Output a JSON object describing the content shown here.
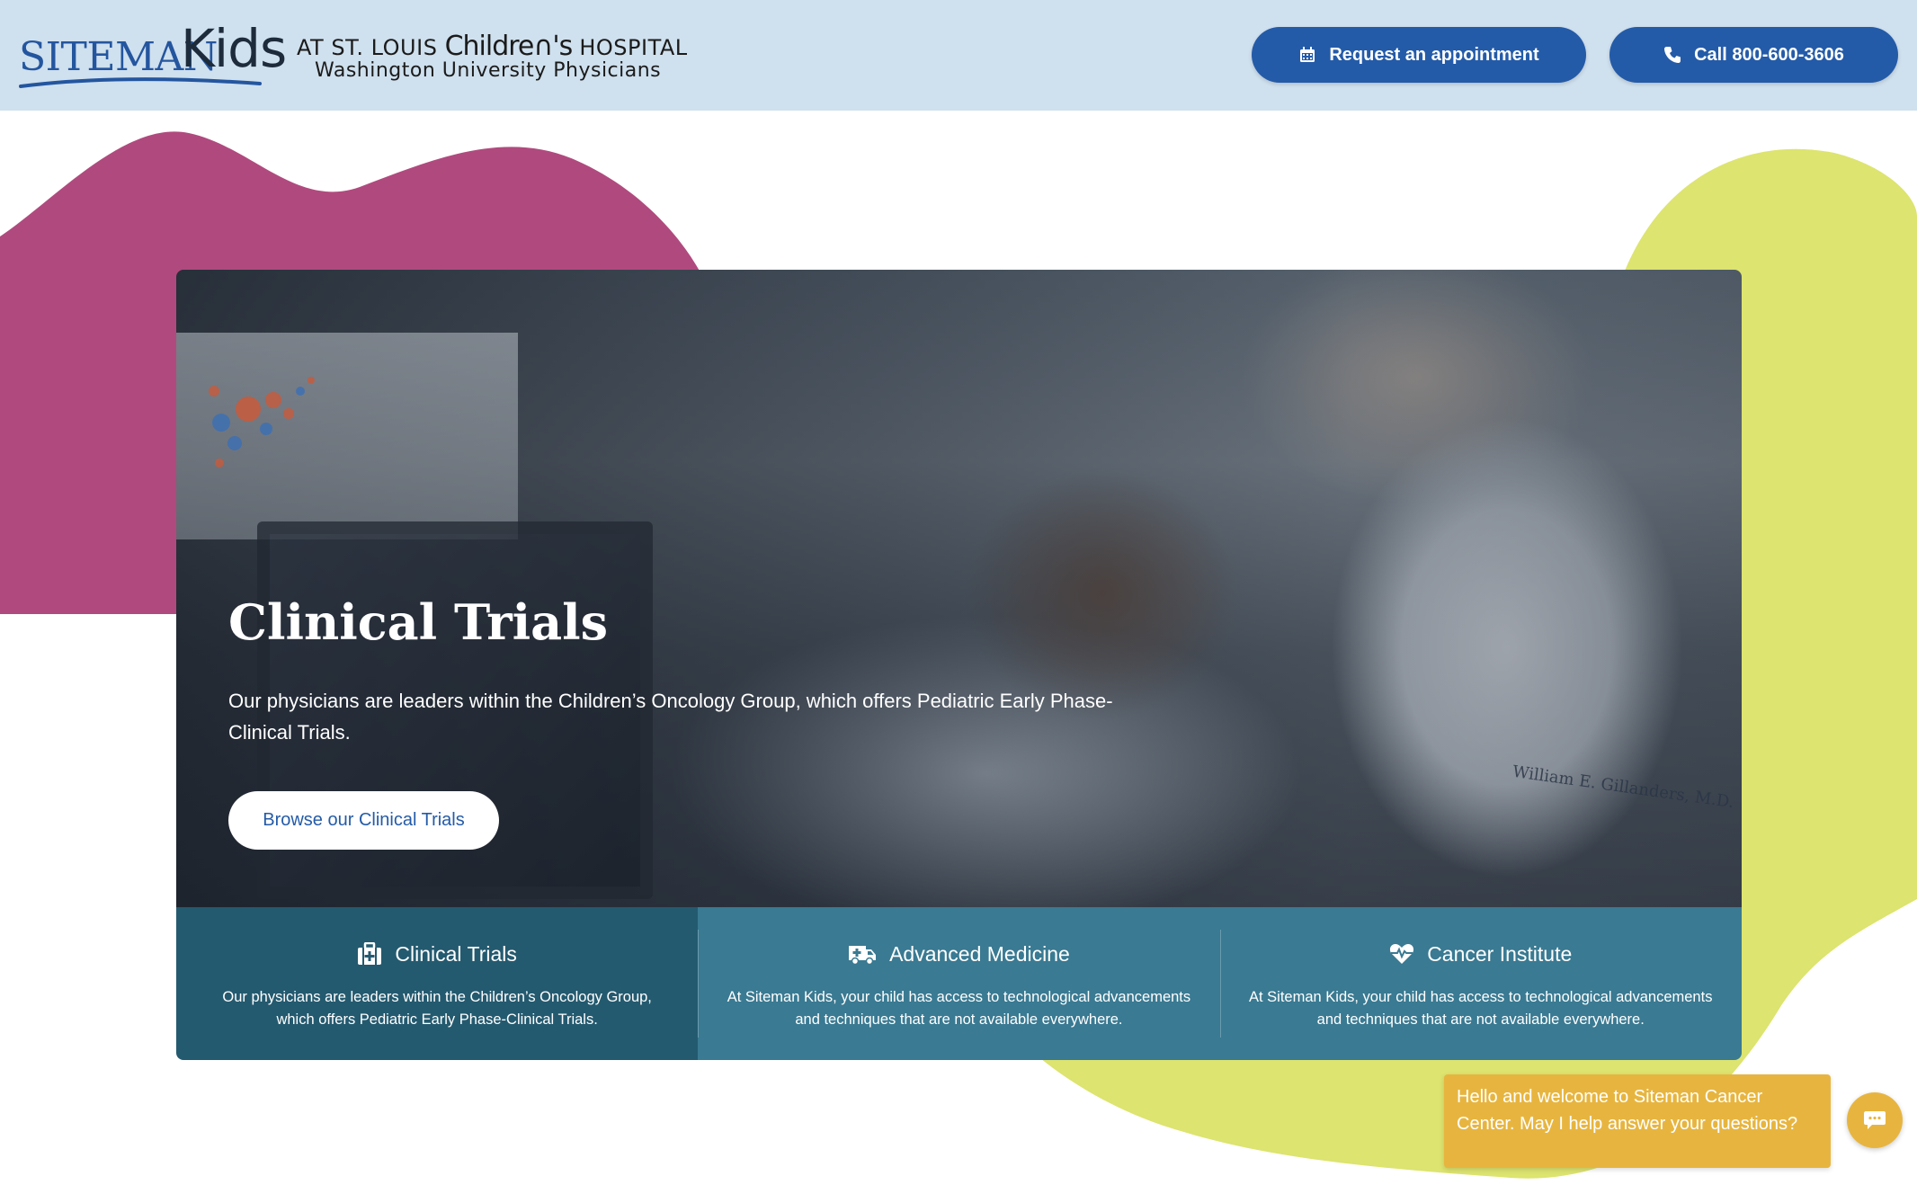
{
  "brand": {
    "siteman": "SITEMAN",
    "kids": "Kids",
    "sub_prefix": "AT ST. LOUIS",
    "sub_childrens": "Childre∩'s",
    "sub_suffix": "HOSPITAL",
    "sub_line2": "Washington University Physicians"
  },
  "header": {
    "appointment_label": "Request an appointment",
    "call_label": "Call 800-600-3606"
  },
  "hero": {
    "title": "Clinical Trials",
    "text": "Our physicians are leaders within the Children’s Oncology Group, which offers Pediatric Early Phase-Clinical Trials.",
    "cta_label": "Browse our Clinical Trials",
    "coat_name": "William E. Gillanders, M.D."
  },
  "features": [
    {
      "title": "Clinical Trials",
      "text": "Our physicians are leaders within the Children’s Oncology Group, which offers Pediatric Early Phase-Clinical Trials.",
      "icon": "medical-kit-icon"
    },
    {
      "title": "Advanced Medicine",
      "text": "At Siteman Kids, your child has access to technological advancements and techniques that are not available everywhere.",
      "icon": "ambulance-icon"
    },
    {
      "title": "Cancer Institute",
      "text": "At Siteman Kids, your child has access to technological advancements and techniques that are not available everywhere.",
      "icon": "heartbeat-icon"
    }
  ],
  "chat": {
    "message": "Hello and welcome to Siteman Cancer Center. May I help answer your questions?",
    "icon": "chat-icon"
  },
  "colors": {
    "header_bg": "#cfe0ee",
    "primary_blue": "#245ba8",
    "blob_magenta": "#b04a7e",
    "blob_lime": "#dde46f",
    "feature_teal": "#3a7a92",
    "feature_active": "#245a6f",
    "chat_yellow": "#e7b53f"
  }
}
